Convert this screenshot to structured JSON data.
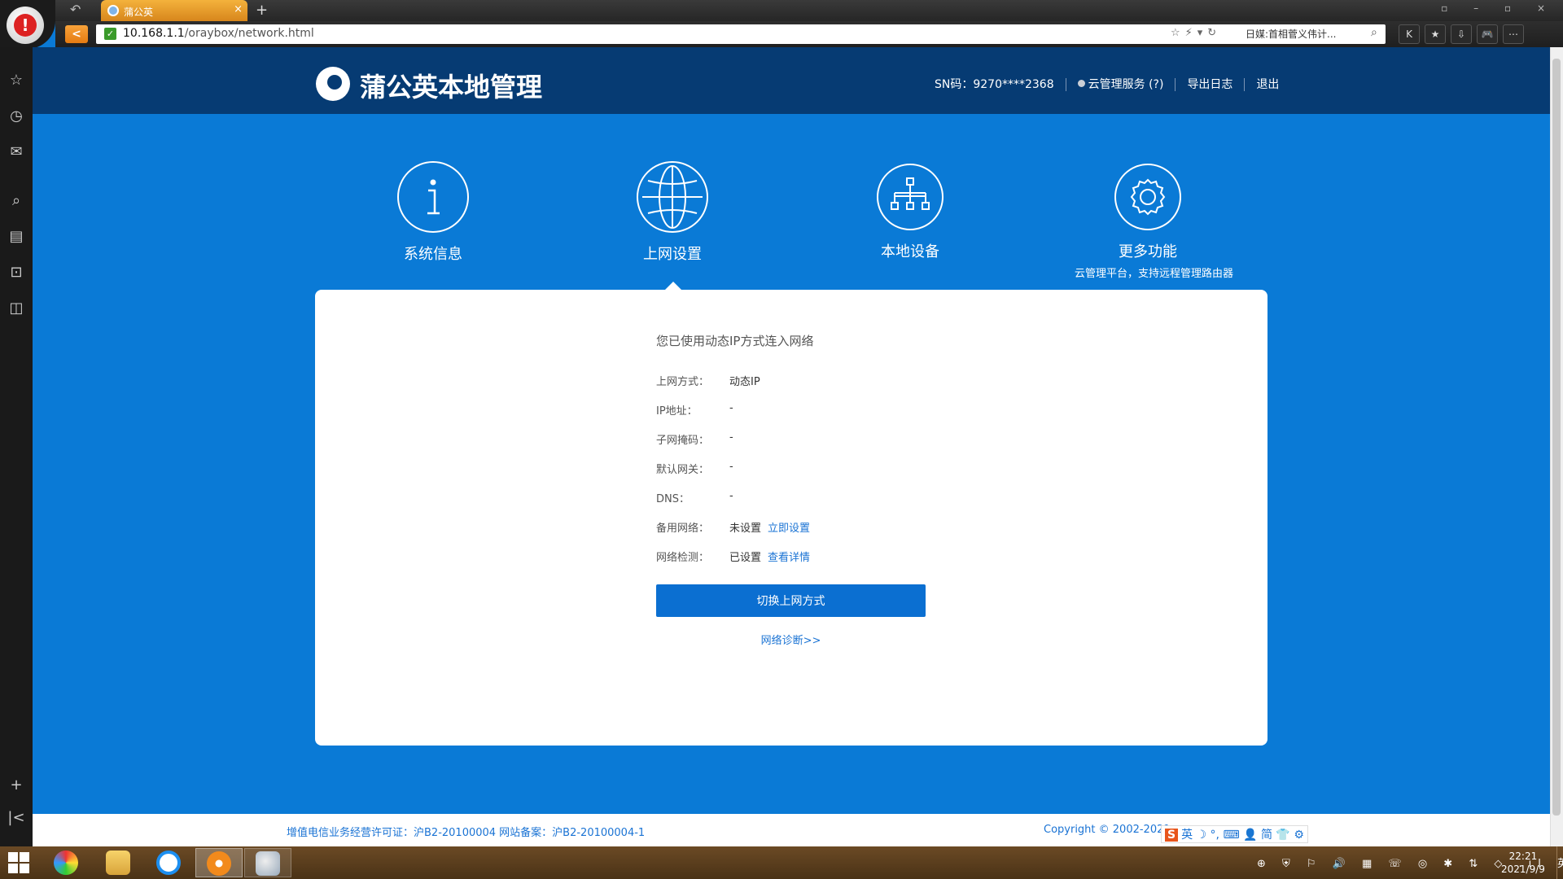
{
  "browser": {
    "tab_title": "蒲公英",
    "tab_close": "×",
    "new_tab": "+",
    "back_history": "↶",
    "back_button": "<",
    "window_controls": "▫ – ▫ ×",
    "url_host": "10.168.1.1",
    "url_path": "/oraybox/network.html",
    "url_tools": "☆⚡▾↻",
    "search_text": "日媒:首相菅义伟计...",
    "right_buttons": [
      "K",
      "★",
      "⇩",
      "🎮",
      "⋯"
    ]
  },
  "sidebar": {
    "icons": [
      "star-icon",
      "history-icon",
      "mail-icon",
      "search-icon",
      "news-icon",
      "bag-icon",
      "game-icon",
      "add-icon",
      "collapse-icon"
    ]
  },
  "header": {
    "logo_text": "蒲公英本地管理",
    "sn": "SN码：9270****2368",
    "cloud_service": "云管理服务 (?)",
    "export_log": "导出日志",
    "logout": "退出"
  },
  "nav": {
    "items": [
      {
        "label": "系统信息",
        "icon": "info-icon"
      },
      {
        "label": "上网设置",
        "icon": "globe-icon",
        "active": true
      },
      {
        "label": "本地设备",
        "icon": "network-tree-icon"
      },
      {
        "label": "更多功能",
        "icon": "gear-icon",
        "sub": "云管理平台，支持远程管理路由器"
      }
    ]
  },
  "network": {
    "status_message": "您已使用动态IP方式连入网络",
    "rows": [
      {
        "label": "上网方式：",
        "value": "动态IP"
      },
      {
        "label": "IP地址：",
        "value": "-"
      },
      {
        "label": "子网掩码：",
        "value": "-"
      },
      {
        "label": "默认网关：",
        "value": "-"
      },
      {
        "label": "DNS：",
        "value": "-"
      },
      {
        "label": "备用网络：",
        "value": "未设置",
        "link": "立即设置"
      },
      {
        "label": "网络检测：",
        "value": "已设置",
        "link": "查看详情"
      }
    ],
    "switch_button": "切换上网方式",
    "diagnose_link": "网络诊断>>"
  },
  "footer": {
    "license": "增值电信业务经营许可证：沪B2-20100004 网站备案：沪B2-20100004-1",
    "copyright": "Copyright © 2002-2021",
    "ime": "英 ☽ °, ⌨ 👤 简 👕 ⚙",
    "ime_logo": "S"
  },
  "taskbar": {
    "tray": "⊕ ⛨ ⚐ 🔊 ▦ ☏ ◎ ✱ ⇅ ◇ .ıl 英",
    "time": "22:21",
    "date": "2021/9/9"
  },
  "colors": {
    "header_bg": "#063b73",
    "page_bg": "#0a7ad6",
    "primary_button": "#0b6fd1",
    "link": "#1a73d4"
  }
}
